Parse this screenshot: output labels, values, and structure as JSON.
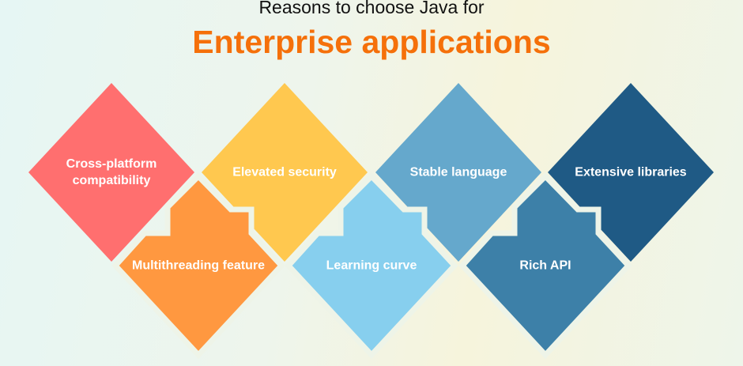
{
  "header": {
    "subtitle": "Reasons to choose Java for",
    "title": "Enterprise applications"
  },
  "reasons": [
    {
      "label": "Cross-platform compatibility",
      "color": "#ff6f6f"
    },
    {
      "label": "Elevated security",
      "color": "#ffc84f"
    },
    {
      "label": "Stable language",
      "color": "#65a8cc"
    },
    {
      "label": "Extensive libraries",
      "color": "#1f5a85"
    },
    {
      "label": "Multithreading feature",
      "color": "#ff9840"
    },
    {
      "label": "Learning curve",
      "color": "#87cfee"
    },
    {
      "label": "Rich API",
      "color": "#3d80a8"
    }
  ]
}
